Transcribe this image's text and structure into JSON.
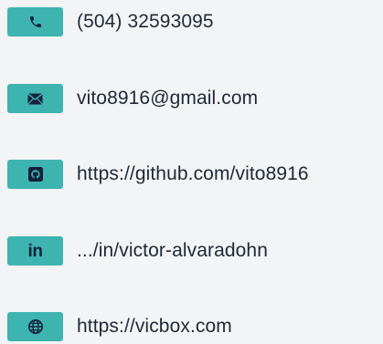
{
  "theme": {
    "badge_color": "#3eb4b0",
    "icon_color": "#16223a",
    "text_color": "#1f2937",
    "background": "#f3f4f6"
  },
  "contacts": [
    {
      "type": "phone",
      "icon": "phone-icon",
      "text": "(504) 32593095"
    },
    {
      "type": "email",
      "icon": "envelope-icon",
      "text": "vito8916@gmail.com"
    },
    {
      "type": "github",
      "icon": "github-icon",
      "text": "https://github.com/vito8916"
    },
    {
      "type": "linkedin",
      "icon": "linkedin-icon",
      "icon_text": "in",
      "text": ".../in/victor-alvaradohn"
    },
    {
      "type": "website",
      "icon": "globe-icon",
      "text": "https://vicbox.com"
    }
  ]
}
